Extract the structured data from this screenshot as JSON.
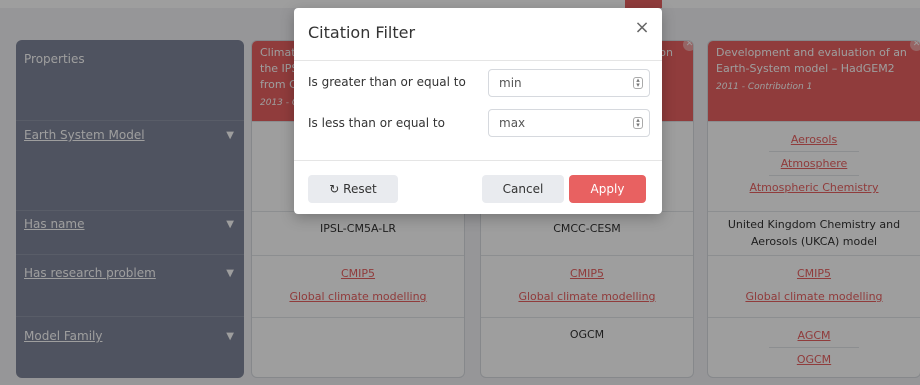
{
  "modal": {
    "title": "Citation Filter",
    "close_symbol": "×",
    "fields": [
      {
        "label": "Is greater than or equal to",
        "placeholder": "min"
      },
      {
        "label": "Is less than or equal to",
        "placeholder": "max"
      }
    ],
    "buttons": {
      "reset_icon": "↻",
      "reset": "Reset",
      "cancel": "Cancel",
      "apply": "Apply"
    }
  },
  "properties": {
    "header": "Properties",
    "rows": [
      {
        "label": "Earth System Model",
        "filter_icon": "▼"
      },
      {
        "label": "Has name",
        "filter_icon": "▼"
      },
      {
        "label": "Has research problem",
        "filter_icon": "▼"
      },
      {
        "label": "Model Family",
        "filter_icon": "▼"
      }
    ]
  },
  "columns": [
    {
      "title": "Climat... the IPS... from C...",
      "title_lines": [
        "Climat",
        "the IPS",
        "from C"
      ],
      "meta": "2013 - C",
      "esm": [],
      "name": "IPSL-CM5A-LR",
      "problems": [
        "CMIP5",
        "Global climate modelling"
      ],
      "family": []
    },
    {
      "title_lines": [
        "on"
      ],
      "meta": "",
      "esm": [],
      "name": "CMCC-CESM",
      "problems": [
        "CMIP5",
        "Global climate modelling"
      ],
      "family": [
        "OGCM"
      ]
    },
    {
      "title_lines": [
        "Development and evaluation of an",
        "Earth-System model – HadGEM2"
      ],
      "meta": "2011 - Contribution 1",
      "esm": [
        "Aerosols",
        "Atmosphere",
        "Atmospheric Chemistry"
      ],
      "name": "United Kingdom Chemistry and Aerosols (UKCA) model",
      "problems": [
        "CMIP5",
        "Global climate modelling"
      ],
      "family": [
        "AGCM",
        "OGCM"
      ]
    }
  ],
  "colors": {
    "accent": "#e86161",
    "sidebar": "#80869b"
  }
}
